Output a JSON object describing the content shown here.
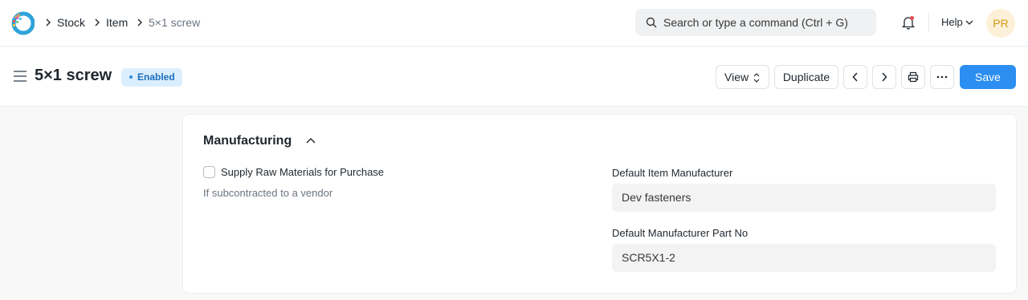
{
  "navbar": {
    "breadcrumbs": [
      "Stock",
      "Item",
      "5×1 screw"
    ],
    "search_placeholder": "Search or type a command (Ctrl + G)",
    "help_label": "Help",
    "avatar_initials": "PR"
  },
  "page": {
    "title": "5×1 screw",
    "status_badge": "Enabled",
    "actions": {
      "view": "View",
      "duplicate": "Duplicate",
      "save": "Save"
    }
  },
  "section": {
    "title": "Manufacturing",
    "supply_raw_materials": {
      "label": "Supply Raw Materials for Purchase",
      "checked": false,
      "description": "If subcontracted to a vendor"
    },
    "default_item_manufacturer": {
      "label": "Default Item Manufacturer",
      "value": "Dev fasteners"
    },
    "default_manufacturer_part_no": {
      "label": "Default Manufacturer Part No",
      "value": "SCR5X1-2"
    }
  },
  "colors": {
    "primary": "#2b8ef0",
    "badge_bg": "#dbeefd",
    "badge_text": "#1a6fbf",
    "page_bg": "#f8f8f8"
  },
  "icons": [
    "app-logo-icon",
    "chevron-right-icon",
    "search-icon",
    "bell-icon",
    "chevron-down-icon",
    "hamburger-icon",
    "sort-arrows-icon",
    "chevron-left-icon",
    "printer-icon",
    "more-icon",
    "chevron-up-icon"
  ]
}
